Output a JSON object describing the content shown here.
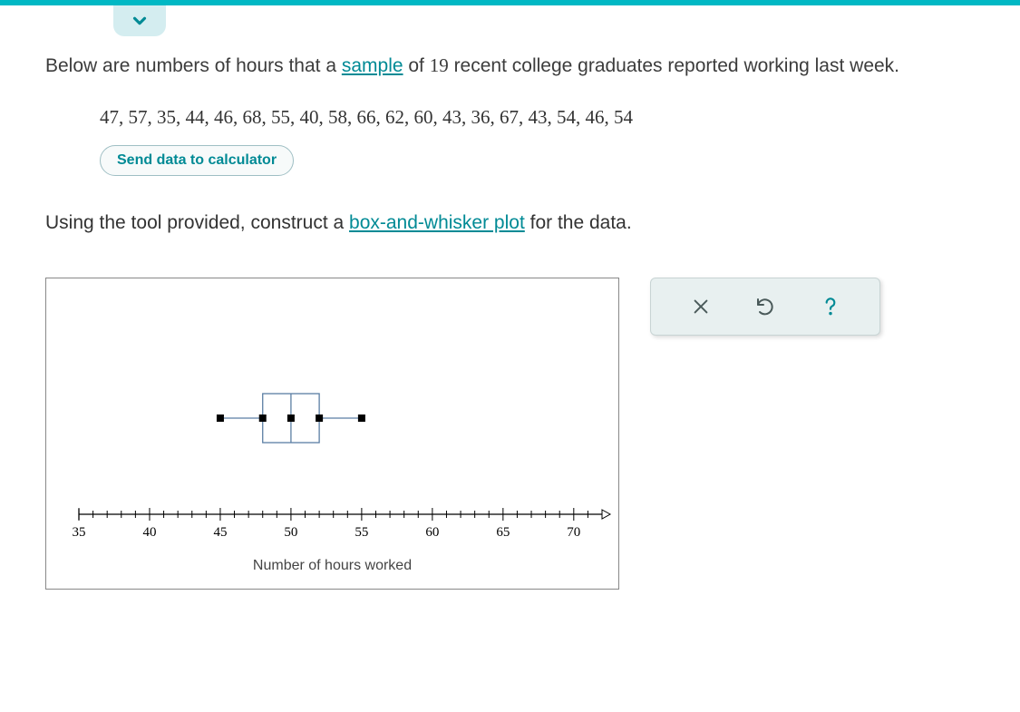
{
  "intro": {
    "pre": "Below are numbers of hours that a ",
    "link1": "sample",
    "mid": " of ",
    "n": "19",
    "post": " recent college graduates reported working last week."
  },
  "data_string": "47, 57, 35, 44, 46, 68, 55, 40, 58, 66, 62, 60, 43, 36, 67, 43, 54, 46, 54",
  "send_btn": "Send data to calculator",
  "instruction": {
    "pre": "Using the tool provided, construct a ",
    "link": "box-and-whisker plot",
    "post": " for the data."
  },
  "chart_data": {
    "type": "boxplot",
    "xlabel": "Number of hours worked",
    "xlim": [
      35,
      72
    ],
    "major_ticks": [
      35,
      40,
      45,
      50,
      55,
      60,
      65,
      70
    ],
    "minor_step": 1,
    "box": {
      "min": 45,
      "q1": 48,
      "median": 50,
      "q3": 52,
      "max": 55
    }
  }
}
